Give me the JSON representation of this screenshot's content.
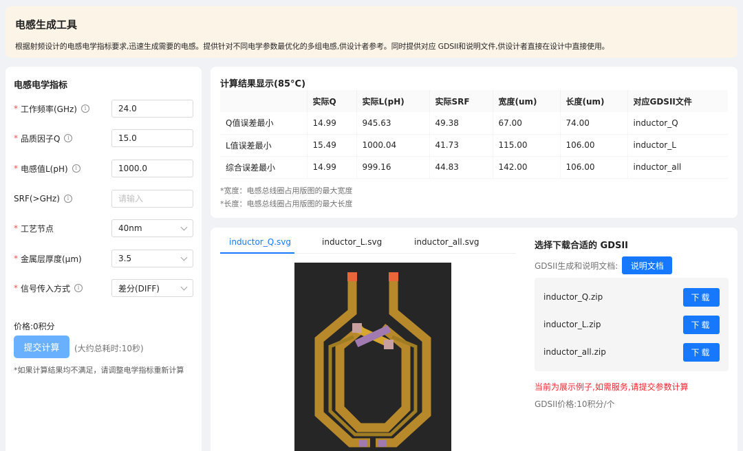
{
  "banner": {
    "title": "电感生成工具",
    "desc": "根据射频设计的电感电学指标要求,迅速生成需要的电感。提供针对不同电学参数最优化的多组电感,供设计者参考。同时提供对应 GDSII和说明文件,供设计者直接在设计中直接使用。"
  },
  "form": {
    "title": "电感电学指标",
    "fields": [
      {
        "label": "工作频率(GHz)",
        "required": true,
        "info": true,
        "value": "24.0",
        "type": "input"
      },
      {
        "label": "品质因子Q",
        "required": true,
        "info": true,
        "value": "15.0",
        "type": "input"
      },
      {
        "label": "电感值L(pH)",
        "required": true,
        "info": true,
        "value": "1000.0",
        "type": "input"
      },
      {
        "label": "SRF(>GHz)",
        "required": false,
        "info": true,
        "value": "",
        "placeholder": "请输入",
        "type": "input"
      },
      {
        "label": "工艺节点",
        "required": true,
        "info": false,
        "value": "40nm",
        "type": "select"
      },
      {
        "label": "金属层厚度(μm)",
        "required": true,
        "info": false,
        "value": "3.5",
        "type": "select"
      },
      {
        "label": "信号传入方式",
        "required": true,
        "info": true,
        "value": "差分(DIFF)",
        "type": "select"
      }
    ],
    "price": "价格:0积分",
    "submit": "提交计算",
    "estimate": "(大约总耗时:10秒)",
    "note": "*如果计算结果均不满足，请调整电学指标重新计算"
  },
  "results": {
    "title": "计算结果显示(85°C)",
    "columns": [
      "",
      "实际Q",
      "实际L(pH)",
      "实际SRF",
      "宽度(um)",
      "长度(um)",
      "对应GDSII文件"
    ],
    "rows": [
      [
        "Q值误差最小",
        "14.99",
        "945.63",
        "49.38",
        "67.00",
        "74.00",
        "inductor_Q"
      ],
      [
        "L值误差最小",
        "15.49",
        "1000.04",
        "41.73",
        "115.00",
        "106.00",
        "inductor_L"
      ],
      [
        "综合误差最小",
        "14.99",
        "999.16",
        "44.83",
        "142.00",
        "106.00",
        "inductor_all"
      ]
    ],
    "foot1": "*宽度：电感总线圈占用版图的最大宽度",
    "foot2": "*长度：电感总线圈占用版图的最大长度"
  },
  "viewer": {
    "tabs": [
      "inductor_Q.svg",
      "inductor_L.svg",
      "inductor_all.svg"
    ],
    "active_tab": 0,
    "colors": {
      "metal": "#b8892a",
      "metal_light": "#d6a62e",
      "via": "#a07ab0",
      "port": "#e8663a",
      "bg": "#262626"
    }
  },
  "download": {
    "title": "选择下载合适的 GDSII",
    "doc_label": "GDSII生成和说明文档:",
    "doc_button": "说明文档",
    "files": [
      "inductor_Q.zip",
      "inductor_L.zip",
      "inductor_all.zip"
    ],
    "download_label": "下载",
    "warning": "当前为展示例子,如需服务,请提交参数计算",
    "price": "GDSII价格:10积分/个"
  }
}
